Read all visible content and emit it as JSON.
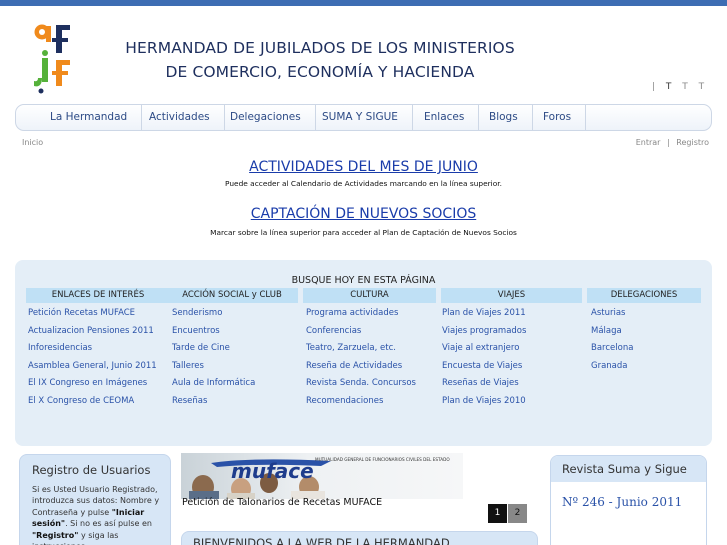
{
  "header": {
    "title_line1": "HERMANDAD DE JUBILADOS DE LOS MINISTERIOS",
    "title_line2": "DE COMERCIO, ECONOMÍA Y HACIENDA",
    "font_size_controls": [
      "T",
      "T",
      "T"
    ]
  },
  "nav": {
    "items": [
      "La Hermandad",
      "Actividades",
      "Delegaciones",
      "SUMA Y SIGUE",
      "Enlaces",
      "Blogs",
      "Foros"
    ]
  },
  "subbar": {
    "home": "Inicio",
    "login": "Entrar",
    "separator": "|",
    "register": "Registro"
  },
  "main": {
    "headline1": "ACTIVIDADES DEL MES DE JUNIO",
    "subline1": "Puede acceder al Calendario de Actividades marcando en la línea superior.",
    "headline2": "CAPTACIÓN DE NUEVOS SOCIOS",
    "subline2": "Marcar sobre la línea superior para acceder al Plan de Captación de Nuevos Socios"
  },
  "links_panel": {
    "title": "BUSQUE HOY EN ESTA PÁGINA",
    "columns": [
      {
        "header": "ENLACES DE INTERÉS",
        "links": [
          "Petición Recetas MUFACE",
          "Actualizacion Pensiones 2011",
          "Inforesidencias",
          "Asamblea General, Junio 2011",
          "El IX Congreso en Imágenes",
          "El X Congreso de CEOMA"
        ]
      },
      {
        "header": "ACCIÓN SOCIAL y CLUB",
        "links": [
          "Senderismo",
          "Encuentros",
          "Tarde de Cine",
          "Talleres",
          "Aula de Informática",
          "Reseñas"
        ]
      },
      {
        "header": "CULTURA",
        "links": [
          "Programa actividades",
          "Conferencias",
          "Teatro, Zarzuela, etc.",
          "Reseña de Actividades",
          "Revista Senda. Concursos",
          "Recomendaciones"
        ]
      },
      {
        "header": "VIAJES",
        "links": [
          "Plan de Viajes 2011",
          "Viajes programados",
          "Viaje al extranjero",
          "Encuesta de Viajes",
          "Reseñas de Viajes",
          "Plan de Viajes 2010"
        ]
      },
      {
        "header": "DELEGACIONES",
        "links": [
          "Asturias",
          "Málaga",
          "Barcelona",
          "Granada"
        ]
      }
    ]
  },
  "registro": {
    "title": "Registro de Usuarios",
    "text_a": "Si es Usted Usuario Registrado, introduzca sus datos: Nombre y Contraseña y pulse ",
    "bold_a": "\"Iniciar sesión\"",
    "text_b": ". Si no es así pulse en ",
    "bold_b": "\"Registro\"",
    "text_c": " y siga las instrucciones."
  },
  "muface": {
    "logo_text": "muface",
    "banner_small": "MUTUALIDAD GENERAL DE FUNCIONARIOS CIVILES DEL ESTADO",
    "caption": "Petición de Talonarios de Recetas MUFACE",
    "pages": [
      "1",
      "2"
    ]
  },
  "welcome": {
    "title": "BIENVENIDOS A LA WEB DE LA HERMANDAD"
  },
  "revista": {
    "title": "Revista Suma y Sigue",
    "issue": "Nº 246 - Junio 2011"
  },
  "colors": {
    "topbar": "#3d6db3",
    "title": "#1e2f5e",
    "link": "#2a52a8",
    "panel_bg": "#e4eef7",
    "col_header_bg": "#bfe0f5",
    "logo_orange": "#f08a1c",
    "logo_green": "#55b13a",
    "logo_navy": "#1e2f5e"
  }
}
